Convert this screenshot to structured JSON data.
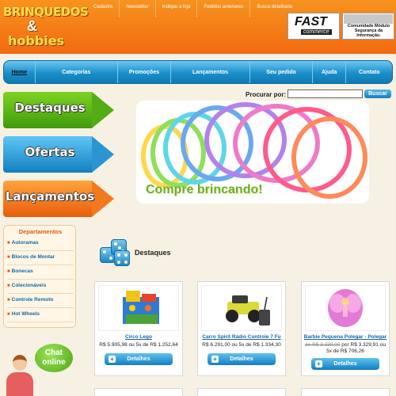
{
  "header": {
    "logo_line1": "BRINQUEDOS",
    "logo_amp": "&",
    "logo_line2": "hobbies",
    "top_links": [
      "Cadastro",
      "Newsletter",
      "Indique a loja",
      "Pedidos anteriores",
      "Busca detalhada"
    ],
    "badge_fast": "FAST",
    "badge_commerce": "commerce",
    "seal_text": "Comunidade Módulo Segurança da Informação."
  },
  "nav": {
    "items": [
      "Home",
      "Categorias",
      "Promoções",
      "Lançamentos",
      "Seu pedido",
      "Ajuda",
      "Contato"
    ]
  },
  "sections": {
    "arrows": [
      "Destaques",
      "Ofertas",
      "Lançamentos"
    ]
  },
  "search": {
    "label": "Procurar por:",
    "value": "",
    "button": "Buscar"
  },
  "banner": {
    "text": "Compre brincando!"
  },
  "departments": {
    "title": "Departamentos",
    "items": [
      "Autoramas",
      "Blocos de Montar",
      "Bonecas",
      "Colecionáveis",
      "Controle Remoto",
      "Hot Wheels"
    ]
  },
  "chat": {
    "line1": "Chat",
    "line2": "online"
  },
  "featured": {
    "title": "Destaques",
    "products": [
      {
        "name": "Circo Lego",
        "old_price": "",
        "price": "R$ 5.905,98 ou 5x de R$ 1.252,64",
        "button": "Detalhes"
      },
      {
        "name": "Carro Spirit Rádio Controle 7 Fu",
        "old_price": "",
        "price": "R$ 6.291,00 ou 5x de R$ 1.334,30",
        "button": "Detalhes"
      },
      {
        "name": "Barbie Pequena Polegar - Polegar",
        "old_price": "de R$ 3.330,00",
        "price": "por R$ 3.329,91 ou 5x de R$ 706,26",
        "button": "Detalhes"
      }
    ]
  },
  "colors": {
    "header_orange": "#f26a10",
    "nav_blue": "#1a8fca",
    "link_blue": "#1668a4",
    "banner_green": "#6cae21"
  }
}
